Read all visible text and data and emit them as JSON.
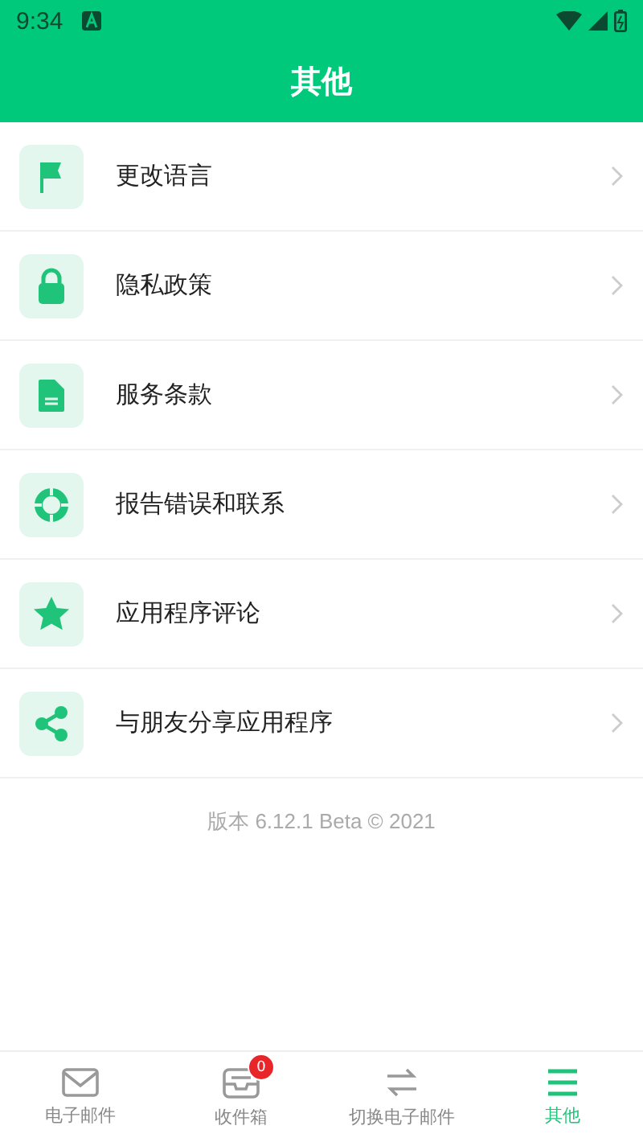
{
  "status_bar": {
    "time": "9:34"
  },
  "header": {
    "title": "其他"
  },
  "menu": [
    {
      "kind": "flag",
      "label": "更改语言"
    },
    {
      "kind": "lock",
      "label": "隐私政策"
    },
    {
      "kind": "document",
      "label": "服务条款"
    },
    {
      "kind": "lifebuoy",
      "label": "报告错误和联系"
    },
    {
      "kind": "star",
      "label": "应用程序评论"
    },
    {
      "kind": "share",
      "label": "与朋友分享应用程序"
    }
  ],
  "version": "版本 6.12.1 Beta © 2021",
  "bottom_nav": [
    {
      "kind": "mail",
      "label": "电子邮件",
      "selected": false
    },
    {
      "kind": "inbox",
      "label": "收件箱",
      "selected": false,
      "badge": "0"
    },
    {
      "kind": "switch",
      "label": "切换电子邮件",
      "selected": false
    },
    {
      "kind": "list",
      "label": "其他",
      "selected": true
    }
  ]
}
